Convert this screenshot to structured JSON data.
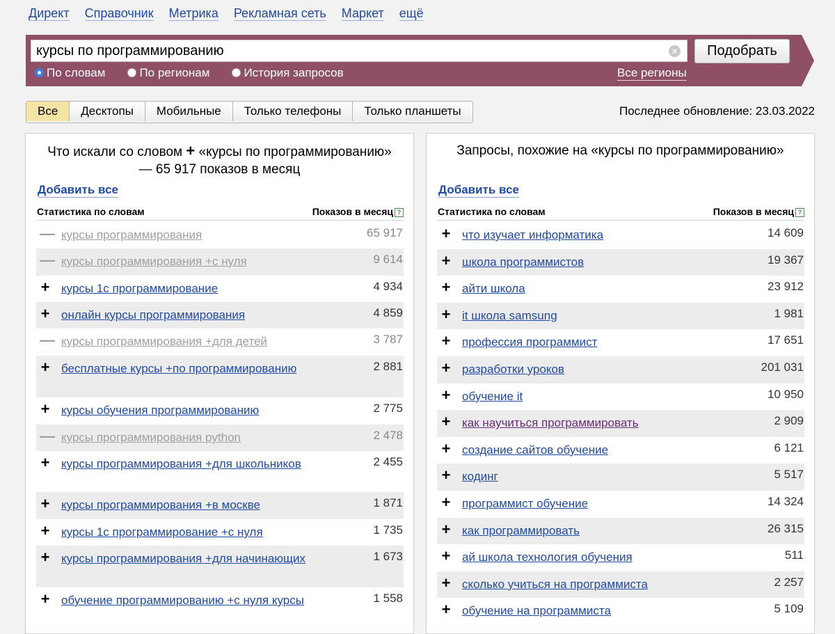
{
  "nav": [
    "Директ",
    "Справочник",
    "Метрика",
    "Рекламная сеть",
    "Маркет",
    "ещё"
  ],
  "search": {
    "value": "курсы по программированию",
    "button": "Подобрать",
    "options": [
      "По словам",
      "По регионам",
      "История запросов"
    ],
    "selected": "По словам",
    "regions": "Все регионы"
  },
  "device_tabs": [
    "Все",
    "Десктопы",
    "Мобильные",
    "Только телефоны",
    "Только планшеты"
  ],
  "active_device": "Все",
  "last_update": "Последнее обновление: 23.03.2022",
  "colors": {
    "band": "#8f4f66",
    "link": "#1f4aa8",
    "active_tab": "#f6e3a6"
  },
  "left": {
    "title_a": "Что искали со словом",
    "title_plus": "+",
    "title_b": "«курсы по программированию» — 65 917 показов в месяц",
    "add_all": "Добавить все",
    "col_phrase": "Статистика по словам",
    "col_count": "Показов в месяц",
    "rows": [
      {
        "op": "—",
        "phrase": "курсы программирования",
        "count": "65 917",
        "dim": true
      },
      {
        "op": "—",
        "phrase": "курсы программирования +с нуля",
        "count": "9 614",
        "dim": true
      },
      {
        "op": "+",
        "phrase": "курсы 1с программирование",
        "count": "4 934"
      },
      {
        "op": "+",
        "phrase": "онлайн курсы программирования",
        "count": "4 859"
      },
      {
        "op": "—",
        "phrase": "курсы программирования +для детей",
        "count": "3 787",
        "dim": true
      },
      {
        "op": "+",
        "phrase": "бесплатные курсы +по программированию",
        "count": "2 881"
      },
      {
        "op": "+",
        "phrase": "курсы обучения программированию",
        "count": "2 775"
      },
      {
        "op": "—",
        "phrase": "курсы программирования python",
        "count": "2 478",
        "dim": true
      },
      {
        "op": "+",
        "phrase": "курсы программирования +для школьников",
        "count": "2 455"
      },
      {
        "op": "+",
        "phrase": "курсы программирования +в москве",
        "count": "1 871"
      },
      {
        "op": "+",
        "phrase": "курсы 1с программирование +с нуля",
        "count": "1 735"
      },
      {
        "op": "+",
        "phrase": "курсы программирования +для начинающих",
        "count": "1 673"
      },
      {
        "op": "+",
        "phrase": "обучение программированию +с нуля курсы",
        "count": "1 558"
      }
    ]
  },
  "right": {
    "title": "Запросы, похожие на «курсы по программированию»",
    "add_all": "Добавить все",
    "col_phrase": "Статистика по словам",
    "col_count": "Показов в месяц",
    "rows": [
      {
        "op": "+",
        "phrase": "что изучает информатика",
        "count": "14 609"
      },
      {
        "op": "+",
        "phrase": "школа программистов",
        "count": "19 367"
      },
      {
        "op": "+",
        "phrase": "айти школа",
        "count": "23 912"
      },
      {
        "op": "+",
        "phrase": "it школа samsung",
        "count": "1 981"
      },
      {
        "op": "+",
        "phrase": "профессия программист",
        "count": "17 651"
      },
      {
        "op": "+",
        "phrase": "разработки уроков",
        "count": "201 031"
      },
      {
        "op": "+",
        "phrase": "обучение it",
        "count": "10 950"
      },
      {
        "op": "+",
        "phrase": "как научиться программировать",
        "count": "2 909",
        "visited": true
      },
      {
        "op": "+",
        "phrase": "создание сайтов обучение",
        "count": "6 121"
      },
      {
        "op": "+",
        "phrase": "кодинг",
        "count": "5 517"
      },
      {
        "op": "+",
        "phrase": "программист обучение",
        "count": "14 324"
      },
      {
        "op": "+",
        "phrase": "как программировать",
        "count": "26 315"
      },
      {
        "op": "+",
        "phrase": "ай школа технология обучения",
        "count": "511"
      },
      {
        "op": "+",
        "phrase": "сколько учиться на программиста",
        "count": "2 257"
      },
      {
        "op": "+",
        "phrase": "обучение на программиста",
        "count": "5 109"
      }
    ]
  }
}
